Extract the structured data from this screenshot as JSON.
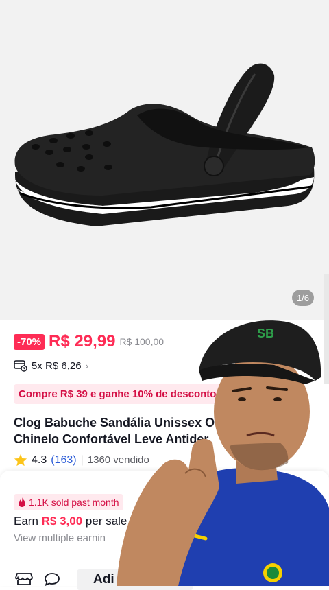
{
  "gallery": {
    "counter": "1/6",
    "image_alt": "black clog shoe with white sole stripe"
  },
  "pricing": {
    "discount": "-70%",
    "price": "R$ 29,99",
    "original_price": "R$ 100,00",
    "installments": "5x R$ 6,26"
  },
  "promo": {
    "text": "Compre R$ 39 e ganhe 10% de desconto"
  },
  "product": {
    "title_line1": "Clog Babuche Sandália Unissex O",
    "title_line2": "Chinelo Confortável Leve Antider"
  },
  "rating": {
    "score": "4.3",
    "count": "(163)",
    "sold": "1360 vendido"
  },
  "affiliate": {
    "sold_badge": "1.1K sold past month",
    "earn_prefix": "Earn ",
    "earn_amount": "R$ 3,00",
    "earn_suffix": " per sale",
    "view_more": "View multiple earnin"
  },
  "bottom_bar": {
    "add_button": "Adi"
  },
  "colors": {
    "accent": "#fe2c55",
    "promo_bg": "#ffe9ee",
    "link": "#2a5bd7"
  }
}
